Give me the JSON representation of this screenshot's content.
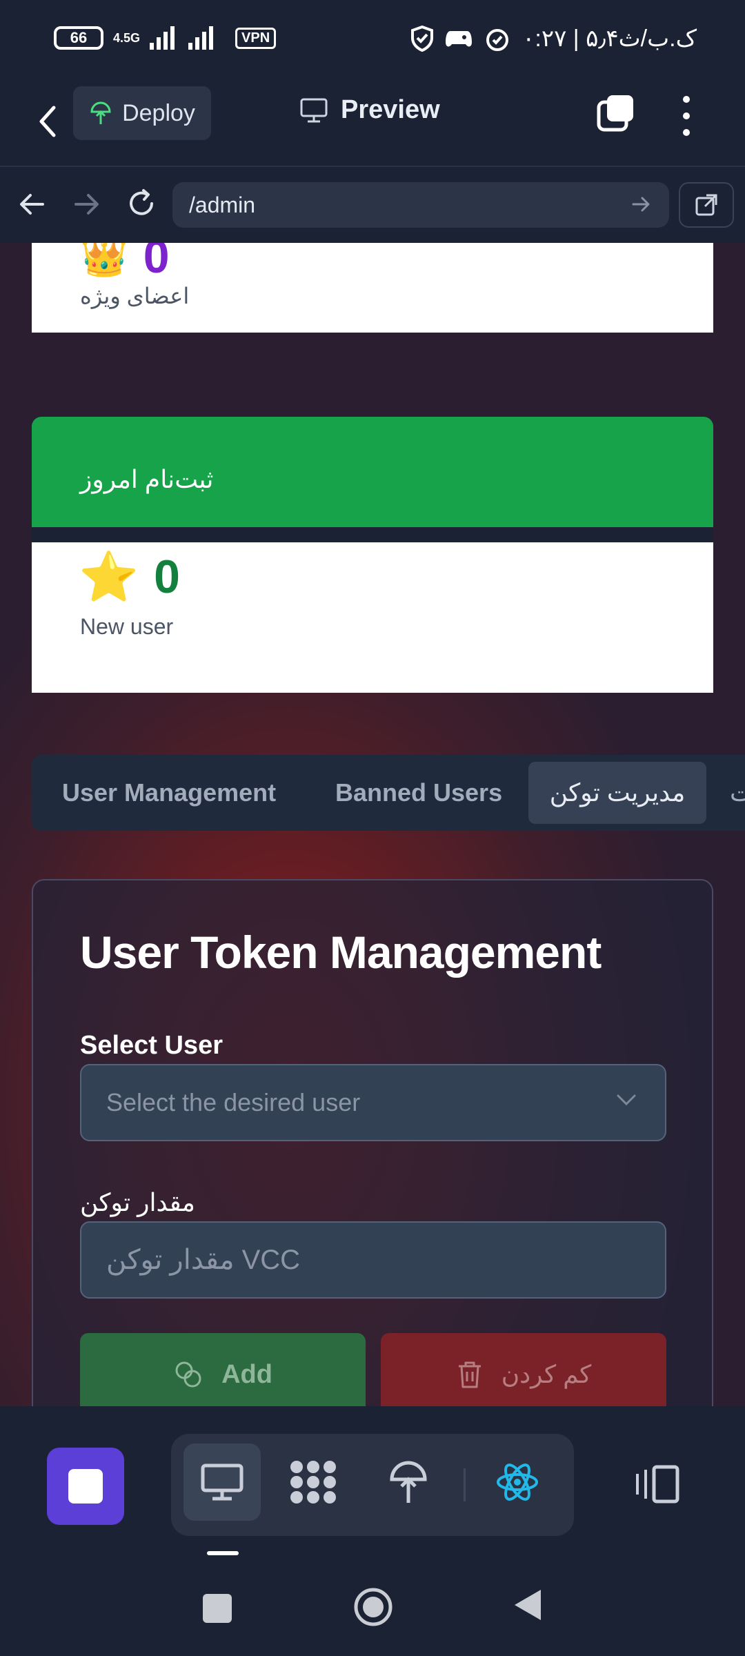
{
  "status_bar": {
    "battery": "66",
    "network": "4.5G",
    "vpn": "VPN",
    "time_text": "۰:۲۷ | ۵٫۴ک.ب/ث"
  },
  "toolbar": {
    "deploy_label": "Deploy",
    "preview_label": "Preview"
  },
  "browser": {
    "url": "/admin"
  },
  "stats": {
    "vip": {
      "value": "0",
      "label": "اعضای ویژه",
      "icon": "crown-icon"
    },
    "today_signups": {
      "header": "ثبت‌نام امروز",
      "value": "0",
      "label": "New user",
      "icon": "star-icon",
      "header_color": "#16a34a"
    }
  },
  "tabs": [
    {
      "label": "User Management"
    },
    {
      "label": "Banned Users"
    },
    {
      "label": "مدیریت توکن"
    },
    {
      "label": "ت"
    }
  ],
  "token_panel": {
    "title": "User Token Management",
    "select_label": "Select User",
    "select_placeholder": "Select the desired user",
    "amount_label": "مقدار توکن",
    "amount_placeholder": "مقدار توکن VCC",
    "add_label": "Add",
    "decrease_label": "کم کردن"
  }
}
